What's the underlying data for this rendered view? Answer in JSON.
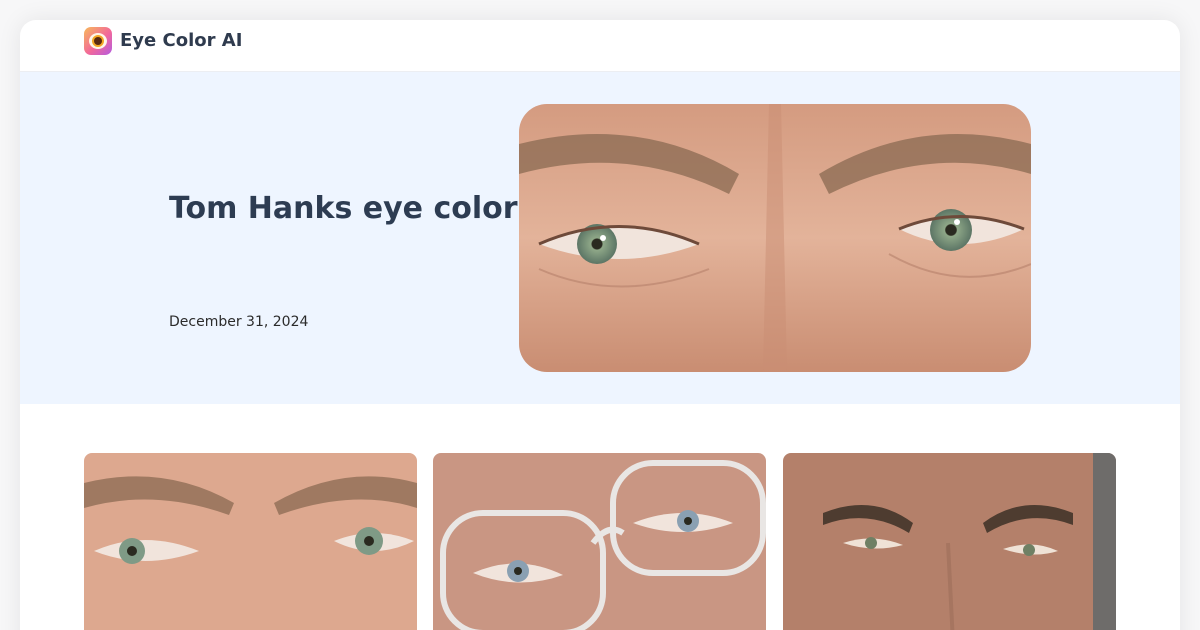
{
  "brand": {
    "name": "Eye Color AI",
    "logo_icon": "eye-logo-icon"
  },
  "hero": {
    "title": "Tom Hanks eye color",
    "date": "December 31, 2024",
    "image_icon": "eyes-closeup-photo"
  },
  "gallery": {
    "items": [
      {
        "icon": "eyes-closeup-photo"
      },
      {
        "icon": "eyes-with-glasses-photo"
      },
      {
        "icon": "face-closeup-photo"
      }
    ]
  },
  "colors": {
    "accent_bg": "#eef5ff",
    "title": "#2d3c52",
    "iris": "#7f9a86"
  }
}
